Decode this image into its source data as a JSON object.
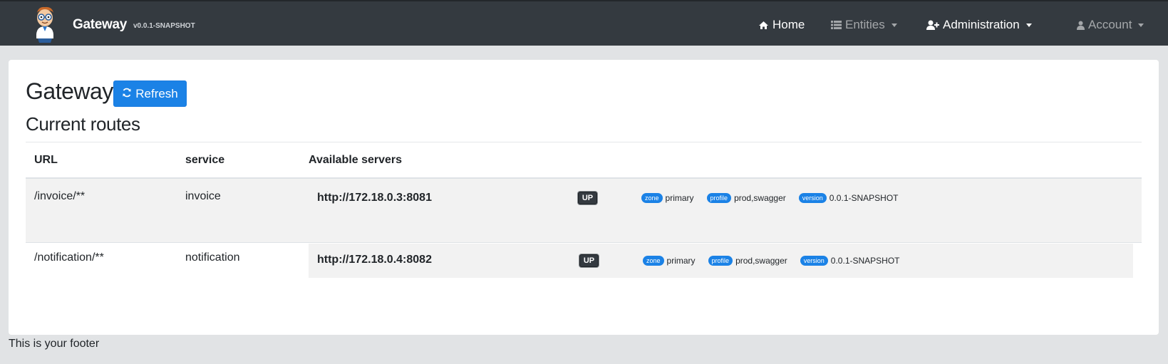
{
  "navbar": {
    "brand_name": "Gateway",
    "brand_version": "v0.0.1-SNAPSHOT",
    "items": [
      {
        "label": "Home",
        "icon": "home-icon"
      },
      {
        "label": "Entities",
        "icon": "th-list-icon"
      },
      {
        "label": "Administration",
        "icon": "user-plus-icon"
      },
      {
        "label": "Account",
        "icon": "user-icon"
      }
    ]
  },
  "page": {
    "title": "Gateway",
    "refresh_label": "Refresh",
    "section_title": "Current routes",
    "columns": [
      "URL",
      "service",
      "Available servers"
    ]
  },
  "routes": [
    {
      "url": "/invoice/**",
      "service": "invoice",
      "server": "http://172.18.0.3:8081",
      "status": "UP",
      "zone_label": "zone",
      "zone": "primary",
      "profile_label": "profile",
      "profile": "prod,swagger",
      "version_label": "version",
      "version": "0.0.1-SNAPSHOT"
    },
    {
      "url": "/notification/**",
      "service": "notification",
      "server": "http://172.18.0.4:8082",
      "status": "UP",
      "zone_label": "zone",
      "zone": "primary",
      "profile_label": "profile",
      "profile": "prod,swagger",
      "version_label": "version",
      "version": "0.0.1-SNAPSHOT"
    }
  ],
  "footer": "This is your footer",
  "colors": {
    "navbar_bg": "#343a40",
    "primary": "#1b82e6",
    "page_bg": "#e1e3e5"
  }
}
